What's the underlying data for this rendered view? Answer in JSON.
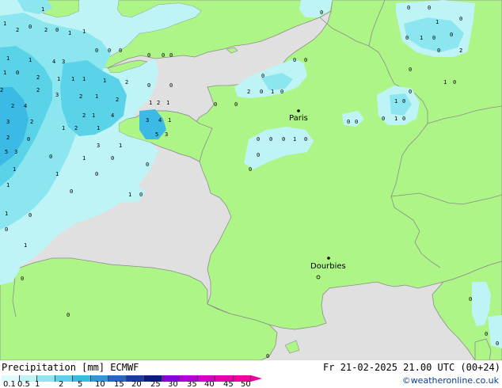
{
  "map": {
    "colors": {
      "sea": "#e0e0e0",
      "land": "#aef587",
      "border": "#8c8c8c",
      "coast": "#8c8c8c"
    },
    "cities": [
      {
        "name": "Paris"
      },
      {
        "name": "Dourbies"
      }
    ],
    "precip_labels": [
      "0",
      "1",
      "2",
      "3",
      "4",
      "5"
    ]
  },
  "footer": {
    "title": "Precipitation [mm] ECMWF",
    "valid": "Fr 21-02-2025 21.00 UTC (00+24)",
    "credit": "©weatheronline.co.uk"
  },
  "legend": {
    "labels": [
      "0.1",
      "0.5",
      "1",
      "2",
      "5",
      "10",
      "15",
      "20",
      "25",
      "30",
      "35",
      "40",
      "45",
      "50"
    ],
    "colors": [
      "#e0fbfb",
      "#bef4f6",
      "#8be6ef",
      "#5ad2e8",
      "#3cbae6",
      "#2f97dc",
      "#2168cc",
      "#1a3aa8",
      "#0a1a86",
      "#8a00d8",
      "#b200d6",
      "#d000c8",
      "#e400b4",
      "#f000a0"
    ],
    "arrow_color": "#f000a0"
  }
}
